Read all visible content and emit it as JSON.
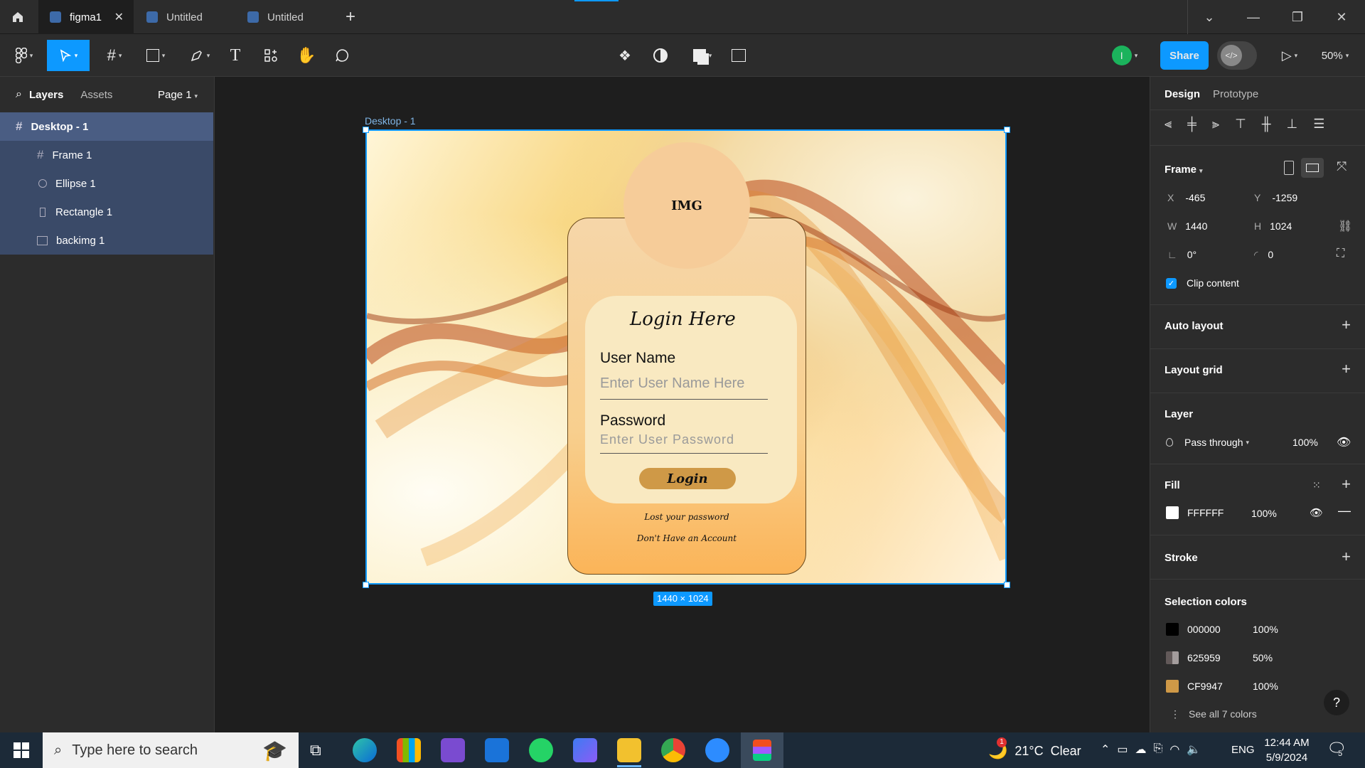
{
  "tabs": {
    "items": [
      {
        "label": "figma1"
      },
      {
        "label": "Untitled"
      },
      {
        "label": "Untitled"
      }
    ]
  },
  "toolbar": {
    "share_label": "Share",
    "zoom": "50%",
    "avatar_initial": "I"
  },
  "left_panel": {
    "tab_layers": "Layers",
    "tab_assets": "Assets",
    "page": "Page 1",
    "layers": [
      {
        "label": "Desktop - 1",
        "type": "frame"
      },
      {
        "label": "Frame 1",
        "type": "frame"
      },
      {
        "label": "Ellipse 1",
        "type": "ellipse"
      },
      {
        "label": "Rectangle 1",
        "type": "rectangle"
      },
      {
        "label": "backimg 1",
        "type": "image"
      }
    ]
  },
  "canvas": {
    "frame_label": "Desktop - 1",
    "size_badge": "1440 × 1024",
    "img_label": "IMG",
    "login_title": "Login Here",
    "username_label": "User Name",
    "username_placeholder": "Enter User Name Here",
    "password_label": "Password",
    "password_placeholder": "Enter User Password",
    "login_button": "Login",
    "lost_password": "Lost your password",
    "no_account": "Don't Have an Account"
  },
  "right_panel": {
    "tab_design": "Design",
    "tab_prototype": "Prototype",
    "frame_title": "Frame",
    "x": "-465",
    "y": "-1259",
    "w": "1440",
    "h": "1024",
    "rotation": "0°",
    "radius": "0",
    "x_label": "X",
    "y_label": "Y",
    "w_label": "W",
    "h_label": "H",
    "clip_content": "Clip content",
    "auto_layout": "Auto layout",
    "layout_grid": "Layout grid",
    "layer_title": "Layer",
    "blend": "Pass through",
    "layer_opacity": "100%",
    "fill_title": "Fill",
    "fill_hex": "FFFFFF",
    "fill_opacity": "100%",
    "stroke_title": "Stroke",
    "selection_colors_title": "Selection colors",
    "selection_colors": [
      {
        "hex": "000000",
        "opacity": "100%",
        "swatch": "#000000"
      },
      {
        "hex": "625959",
        "opacity": "50%",
        "swatch": "#625959"
      },
      {
        "hex": "CF9947",
        "opacity": "100%",
        "swatch": "#CF9947"
      }
    ],
    "see_all": "See all 7 colors",
    "help": "?"
  },
  "taskbar": {
    "search_placeholder": "Type here to search",
    "weather": "21°C  Clear",
    "weather_badge": "1",
    "lang": "ENG",
    "time": "12:44 AM",
    "date": "5/9/2024",
    "notif_count": "5"
  }
}
